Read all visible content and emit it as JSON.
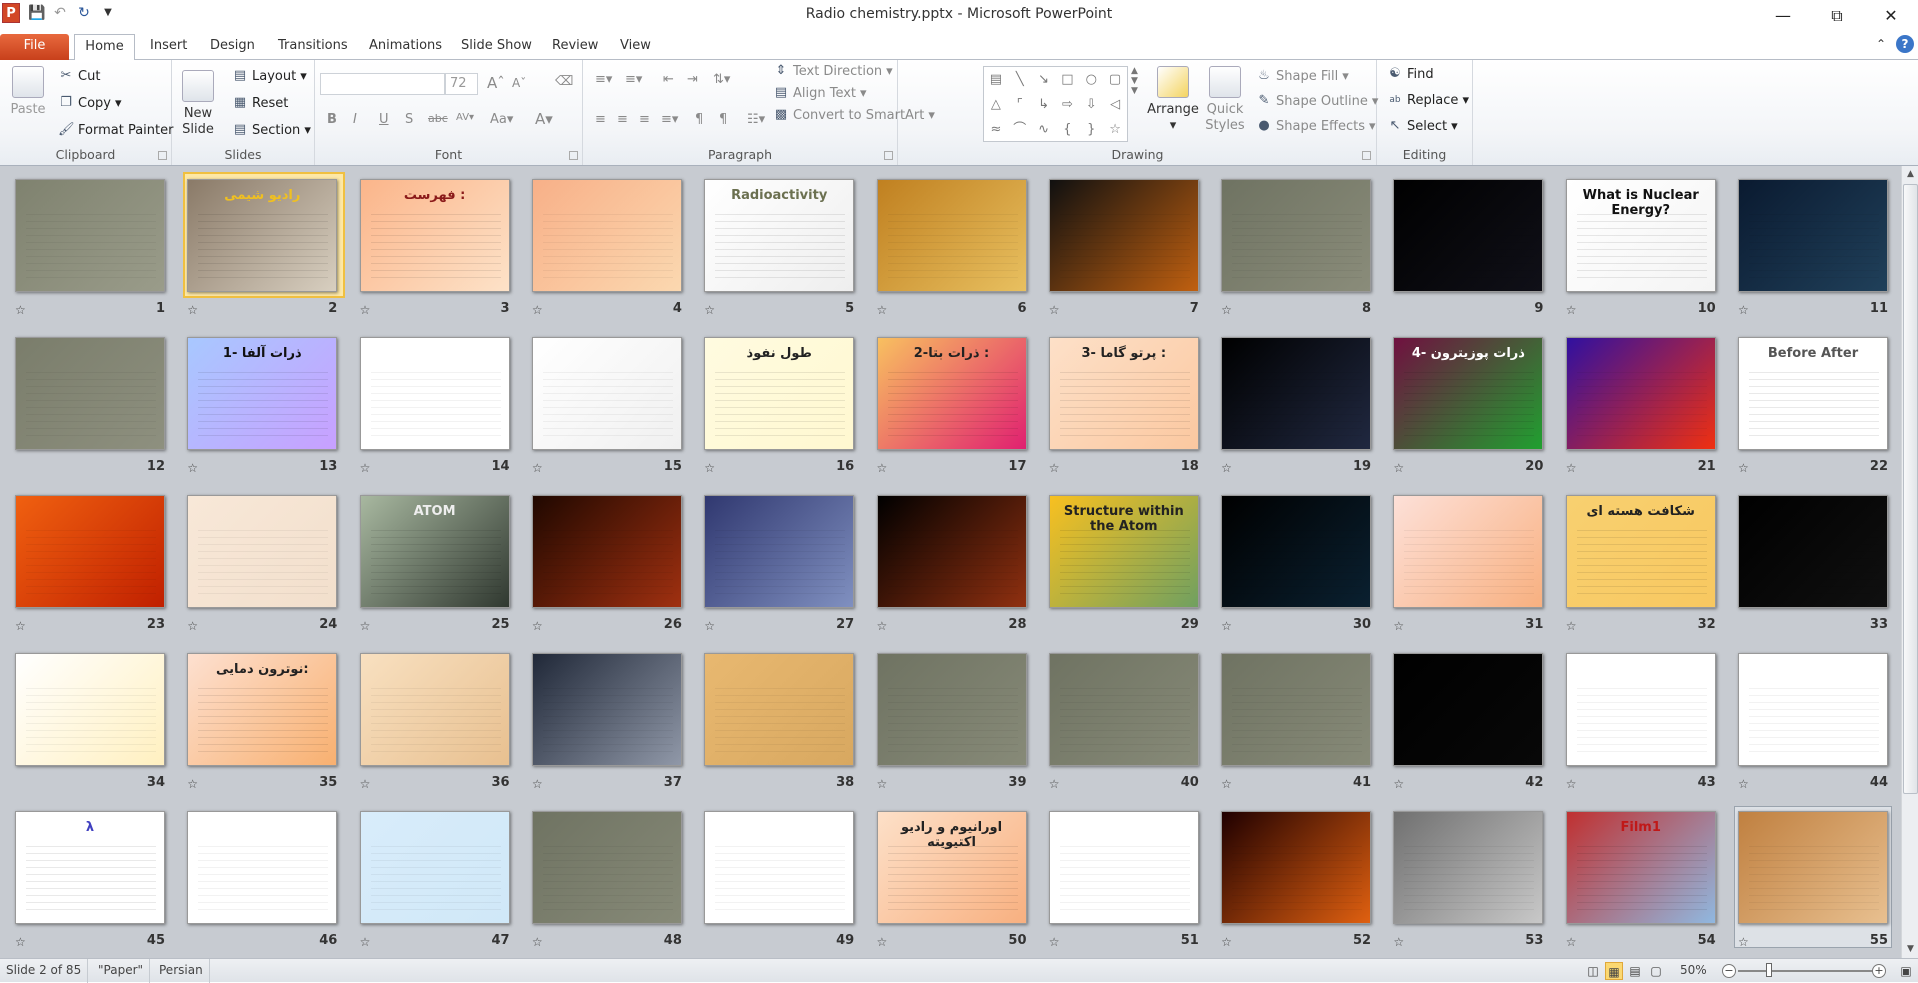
{
  "window": {
    "title": "Radio chemistry.pptx - Microsoft PowerPoint",
    "app_icon": "P"
  },
  "tabs": [
    "File",
    "Home",
    "Insert",
    "Design",
    "Transitions",
    "Animations",
    "Slide Show",
    "Review",
    "View"
  ],
  "ribbon": {
    "clipboard": {
      "label": "Clipboard",
      "paste": "Paste",
      "cut": "Cut",
      "copy": "Copy",
      "format_painter": "Format Painter"
    },
    "slides": {
      "label": "Slides",
      "new_slide_1": "New",
      "new_slide_2": "Slide",
      "layout": "Layout",
      "reset": "Reset",
      "section": "Section"
    },
    "font": {
      "label": "Font",
      "font_name": "",
      "font_size": "72"
    },
    "paragraph": {
      "label": "Paragraph",
      "text_direction": "Text Direction",
      "align_text": "Align Text",
      "convert_smartart": "Convert to SmartArt"
    },
    "drawing": {
      "label": "Drawing",
      "arrange": "Arrange",
      "quick_styles_1": "Quick",
      "quick_styles_2": "Styles",
      "shape_fill": "Shape Fill",
      "shape_outline": "Shape Outline",
      "shape_effects": "Shape Effects"
    },
    "editing": {
      "label": "Editing",
      "find": "Find",
      "replace": "Replace",
      "select": "Select"
    }
  },
  "status": {
    "slide": "Slide 2 of 85",
    "theme": "\"Paper\"",
    "language": "Persian",
    "zoom": "50%",
    "zoom_level": 50
  },
  "selected_slide": 2,
  "slides": [
    {
      "n": 1,
      "star": true,
      "c": [
        "#7f826f",
        "#9a9c8a"
      ],
      "t": "",
      "tc": "#111"
    },
    {
      "n": 2,
      "star": true,
      "c": [
        "#8a7a68",
        "#d8cfc0"
      ],
      "t": "رادیو شیمی",
      "tc": "#f0c020"
    },
    {
      "n": 3,
      "star": true,
      "c": [
        "#fbb58a",
        "#fde2c8"
      ],
      "t": "فهرست :",
      "tc": "#8b1a1a"
    },
    {
      "n": 4,
      "star": true,
      "c": [
        "#f8b088",
        "#fbd8b0"
      ],
      "t": "",
      "tc": "#222"
    },
    {
      "n": 5,
      "star": true,
      "c": [
        "#ffffff",
        "#eeeeee"
      ],
      "t": "Radioactivity",
      "tc": "#6b7050"
    },
    {
      "n": 6,
      "star": true,
      "c": [
        "#c08020",
        "#e8c060"
      ],
      "t": "",
      "tc": "#222"
    },
    {
      "n": 7,
      "star": true,
      "c": [
        "#101010",
        "#c06010"
      ],
      "t": "",
      "tc": "#ffe040"
    },
    {
      "n": 8,
      "star": true,
      "c": [
        "#6f7362",
        "#8a8c7a"
      ],
      "t": "",
      "tc": "#ddd"
    },
    {
      "n": 9,
      "star": false,
      "c": [
        "#000000",
        "#101018"
      ],
      "t": "",
      "tc": "#e33"
    },
    {
      "n": 10,
      "star": true,
      "c": [
        "#ffffff",
        "#f4f4f4"
      ],
      "t": "What is Nuclear Energy?",
      "tc": "#111"
    },
    {
      "n": 11,
      "star": true,
      "c": [
        "#0a1a30",
        "#20405a"
      ],
      "t": "",
      "tc": "#f0c020"
    },
    {
      "n": 12,
      "star": false,
      "c": [
        "#7a7d6b",
        "#8e907f"
      ],
      "t": "",
      "tc": "#222"
    },
    {
      "n": 13,
      "star": true,
      "c": [
        "#a8c8ff",
        "#c8a0ff"
      ],
      "t": "1- ذرات آلفا",
      "tc": "#111"
    },
    {
      "n": 14,
      "star": true,
      "c": [
        "#ffffff",
        "#ffffff"
      ],
      "t": "",
      "tc": "#c04050"
    },
    {
      "n": 15,
      "star": true,
      "c": [
        "#ffffff",
        "#f0f0f0"
      ],
      "t": "",
      "tc": "#1a80d0"
    },
    {
      "n": 16,
      "star": true,
      "c": [
        "#fffbe0",
        "#fff8d0"
      ],
      "t": "طول نفوذ",
      "tc": "#222"
    },
    {
      "n": 17,
      "star": true,
      "c": [
        "#f8c060",
        "#e02070"
      ],
      "t": "2-ذرات بتا :",
      "tc": "#222"
    },
    {
      "n": 18,
      "star": true,
      "c": [
        "#fde0c8",
        "#fbc8a0"
      ],
      "t": "3- پرتو گاما :",
      "tc": "#222"
    },
    {
      "n": 19,
      "star": true,
      "c": [
        "#000000",
        "#202840"
      ],
      "t": "",
      "tc": "#fff"
    },
    {
      "n": 20,
      "star": true,
      "c": [
        "#701040",
        "#20a030"
      ],
      "t": "4- ذرات پوزیترون",
      "tc": "#fff"
    },
    {
      "n": 21,
      "star": true,
      "c": [
        "#3010a0",
        "#f03010"
      ],
      "t": "",
      "tc": "#ffe040"
    },
    {
      "n": 22,
      "star": true,
      "c": [
        "#ffffff",
        "#ffffff"
      ],
      "t": "Before   After",
      "tc": "#555"
    },
    {
      "n": 23,
      "star": true,
      "c": [
        "#f06010",
        "#c02000"
      ],
      "t": "",
      "tc": "#ffe040"
    },
    {
      "n": 24,
      "star": true,
      "c": [
        "#f8e8d8",
        "#f2dfcc"
      ],
      "t": "",
      "tc": "#222"
    },
    {
      "n": 25,
      "star": true,
      "c": [
        "#a8b8a0",
        "#303830"
      ],
      "t": "ATOM",
      "tc": "#eee"
    },
    {
      "n": 26,
      "star": true,
      "c": [
        "#200800",
        "#a03010"
      ],
      "t": "",
      "tc": "#fff"
    },
    {
      "n": 27,
      "star": true,
      "c": [
        "#303870",
        "#8090c0"
      ],
      "t": "",
      "tc": "#fff"
    },
    {
      "n": 28,
      "star": true,
      "c": [
        "#000000",
        "#903010"
      ],
      "t": "",
      "tc": "#fff"
    },
    {
      "n": 29,
      "star": false,
      "c": [
        "#f8c020",
        "#70a060"
      ],
      "t": "Structure within the Atom",
      "tc": "#222"
    },
    {
      "n": 30,
      "star": true,
      "c": [
        "#000000",
        "#0a2030"
      ],
      "t": "",
      "tc": "#40a0ff"
    },
    {
      "n": 31,
      "star": true,
      "c": [
        "#fde0d8",
        "#f8b080"
      ],
      "t": "",
      "tc": "#222"
    },
    {
      "n": 32,
      "star": true,
      "c": [
        "#f8d070",
        "#f8c860"
      ],
      "t": "شکافت هسته ای",
      "tc": "#222"
    },
    {
      "n": 33,
      "star": false,
      "c": [
        "#000000",
        "#101010"
      ],
      "t": "",
      "tc": "#fff"
    },
    {
      "n": 34,
      "star": false,
      "c": [
        "#ffffff",
        "#fff0c0"
      ],
      "t": "",
      "tc": "#222"
    },
    {
      "n": 35,
      "star": true,
      "c": [
        "#fde0d0",
        "#f8b070"
      ],
      "t": "نوترون دمایی:",
      "tc": "#222"
    },
    {
      "n": 36,
      "star": true,
      "c": [
        "#f8e0c0",
        "#e8c090"
      ],
      "t": "",
      "tc": "#222"
    },
    {
      "n": 37,
      "star": true,
      "c": [
        "#202838",
        "#9098a8"
      ],
      "t": "",
      "tc": "#fff"
    },
    {
      "n": 38,
      "star": false,
      "c": [
        "#e8b870",
        "#d8a860"
      ],
      "t": "",
      "tc": "#222"
    },
    {
      "n": 39,
      "star": true,
      "c": [
        "#6f7362",
        "#878a78"
      ],
      "t": "",
      "tc": "#eee"
    },
    {
      "n": 40,
      "star": true,
      "c": [
        "#6f7362",
        "#878a78"
      ],
      "t": "",
      "tc": "#eee"
    },
    {
      "n": 41,
      "star": true,
      "c": [
        "#6f7362",
        "#878a78"
      ],
      "t": "",
      "tc": "#eee"
    },
    {
      "n": 42,
      "star": true,
      "c": [
        "#000000",
        "#080808"
      ],
      "t": "",
      "tc": "#fff"
    },
    {
      "n": 43,
      "star": true,
      "c": [
        "#ffffff",
        "#ffffff"
      ],
      "t": "",
      "tc": "#222"
    },
    {
      "n": 44,
      "star": true,
      "c": [
        "#ffffff",
        "#ffffff"
      ],
      "t": "",
      "tc": "#222"
    },
    {
      "n": 45,
      "star": true,
      "c": [
        "#ffffff",
        "#ffffff"
      ],
      "t": "λ",
      "tc": "#4040c0"
    },
    {
      "n": 46,
      "star": false,
      "c": [
        "#ffffff",
        "#ffffff"
      ],
      "t": "",
      "tc": "#222"
    },
    {
      "n": 47,
      "star": true,
      "c": [
        "#d8ecfa",
        "#d0e8f8"
      ],
      "t": "",
      "tc": "#222"
    },
    {
      "n": 48,
      "star": true,
      "c": [
        "#6f7362",
        "#878a78"
      ],
      "t": "",
      "tc": "#eee"
    },
    {
      "n": 49,
      "star": false,
      "c": [
        "#ffffff",
        "#ffffff"
      ],
      "t": "",
      "tc": "#222"
    },
    {
      "n": 50,
      "star": true,
      "c": [
        "#fde0c8",
        "#f8b080"
      ],
      "t": "اورانیوم و رادیو اکتیویته",
      "tc": "#222"
    },
    {
      "n": 51,
      "star": true,
      "c": [
        "#ffffff",
        "#ffffff"
      ],
      "t": "",
      "tc": "#222"
    },
    {
      "n": 52,
      "star": true,
      "c": [
        "#200000",
        "#e06010"
      ],
      "t": "",
      "tc": "#fff"
    },
    {
      "n": 53,
      "star": true,
      "c": [
        "#707070",
        "#c8c8c8"
      ],
      "t": "",
      "tc": "#ffe040"
    },
    {
      "n": 54,
      "star": true,
      "c": [
        "#c03030",
        "#90b8e0"
      ],
      "t": "Film1",
      "tc": "#c01818"
    },
    {
      "n": 55,
      "star": true,
      "c": [
        "#c08040",
        "#e8c090"
      ],
      "t": "",
      "tc": "#222"
    }
  ]
}
